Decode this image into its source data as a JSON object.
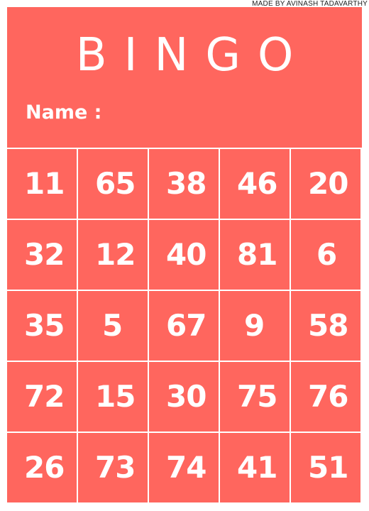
{
  "credit": "MADE BY AVINASH TADAVARTHY",
  "title": "BINGO",
  "name_label": "Name :",
  "colors": {
    "card": "#ff665e",
    "text": "#ffffff",
    "grid_lines": "#ffffff"
  },
  "board": [
    [
      "11",
      "65",
      "38",
      "46",
      "20"
    ],
    [
      "32",
      "12",
      "40",
      "81",
      "6"
    ],
    [
      "35",
      "5",
      "67",
      "9",
      "58"
    ],
    [
      "72",
      "15",
      "30",
      "75",
      "76"
    ],
    [
      "26",
      "73",
      "74",
      "41",
      "51"
    ]
  ]
}
